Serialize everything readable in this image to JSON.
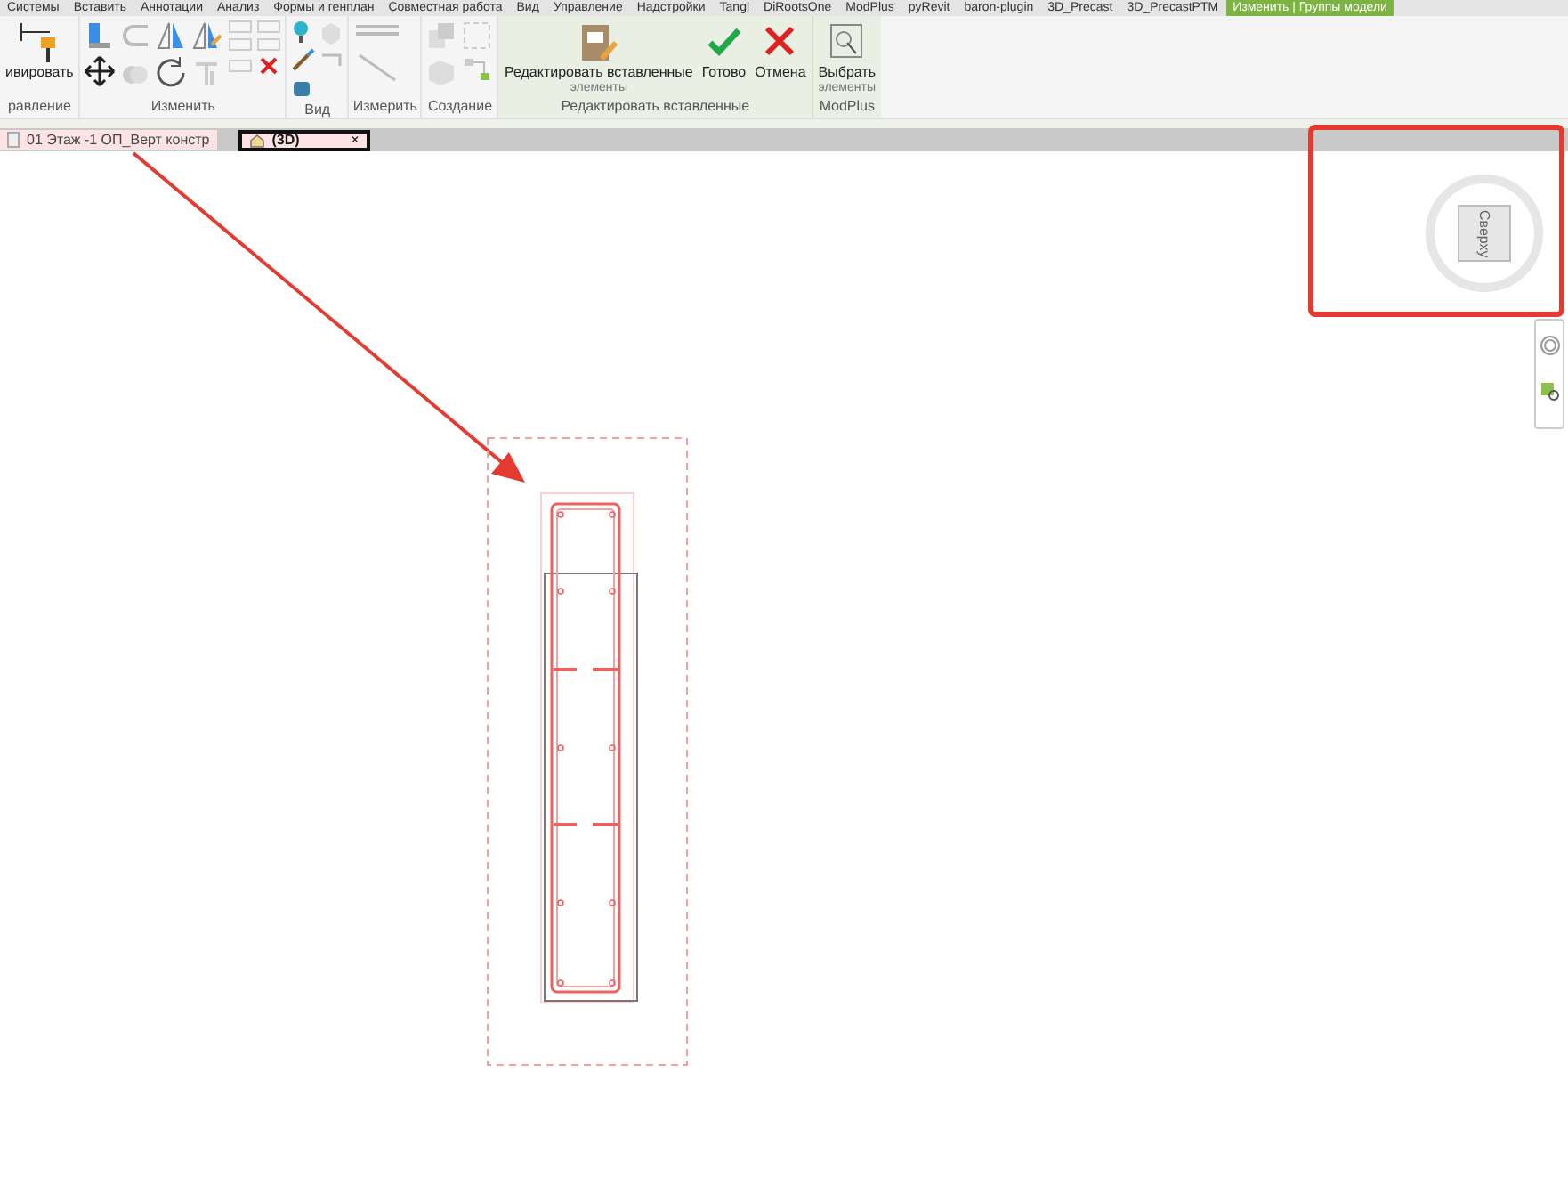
{
  "ribbon_tabs": [
    {
      "label": "Системы",
      "selected": false
    },
    {
      "label": "Вставить",
      "selected": false
    },
    {
      "label": "Аннотации",
      "selected": false
    },
    {
      "label": "Анализ",
      "selected": false
    },
    {
      "label": "Формы и генплан",
      "selected": false
    },
    {
      "label": "Совместная работа",
      "selected": false
    },
    {
      "label": "Вид",
      "selected": false
    },
    {
      "label": "Управление",
      "selected": false
    },
    {
      "label": "Надстройки",
      "selected": false
    },
    {
      "label": "Tangl",
      "selected": false
    },
    {
      "label": "DiRootsOne",
      "selected": false
    },
    {
      "label": "ModPlus",
      "selected": false
    },
    {
      "label": "pyRevit",
      "selected": false
    },
    {
      "label": "baron-plugin",
      "selected": false
    },
    {
      "label": "3D_Precast",
      "selected": false
    },
    {
      "label": "3D_PrecastPTM",
      "selected": false
    },
    {
      "label": "Изменить | Группы модели",
      "selected": true
    }
  ],
  "panels": [
    {
      "kind": "activate",
      "label": "равление",
      "contextual": false,
      "buttons": [
        {
          "label": "ивировать",
          "kind": "pin"
        }
      ]
    },
    {
      "kind": "modify",
      "label": "Изменить",
      "contextual": false
    },
    {
      "kind": "view",
      "label": "Вид",
      "contextual": false
    },
    {
      "kind": "measure",
      "label": "Измерить",
      "contextual": false
    },
    {
      "kind": "create",
      "label": "Создание",
      "contextual": false
    },
    {
      "kind": "edit",
      "label": "Редактировать вставленные",
      "contextual": true,
      "buttons": [
        {
          "label": "Редактировать вставленные",
          "label_cut": "элементы",
          "kind": "clipboard"
        },
        {
          "label": "Готово",
          "kind": "check"
        },
        {
          "label": "Отмена",
          "kind": "cross"
        }
      ]
    },
    {
      "kind": "modplus",
      "label": "ModPlus",
      "contextual": true,
      "buttons": [
        {
          "label": "Выбрать",
          "label_cut": "элементы",
          "kind": "select"
        }
      ]
    }
  ],
  "view_tabs": [
    {
      "label": "01 Этаж -1 ОП_Верт констр",
      "kind": "plan",
      "selected": false
    },
    {
      "label": "(3D)",
      "kind": "model",
      "selected": true,
      "close": "×"
    }
  ],
  "view_cube": {
    "face": "Сверху"
  }
}
